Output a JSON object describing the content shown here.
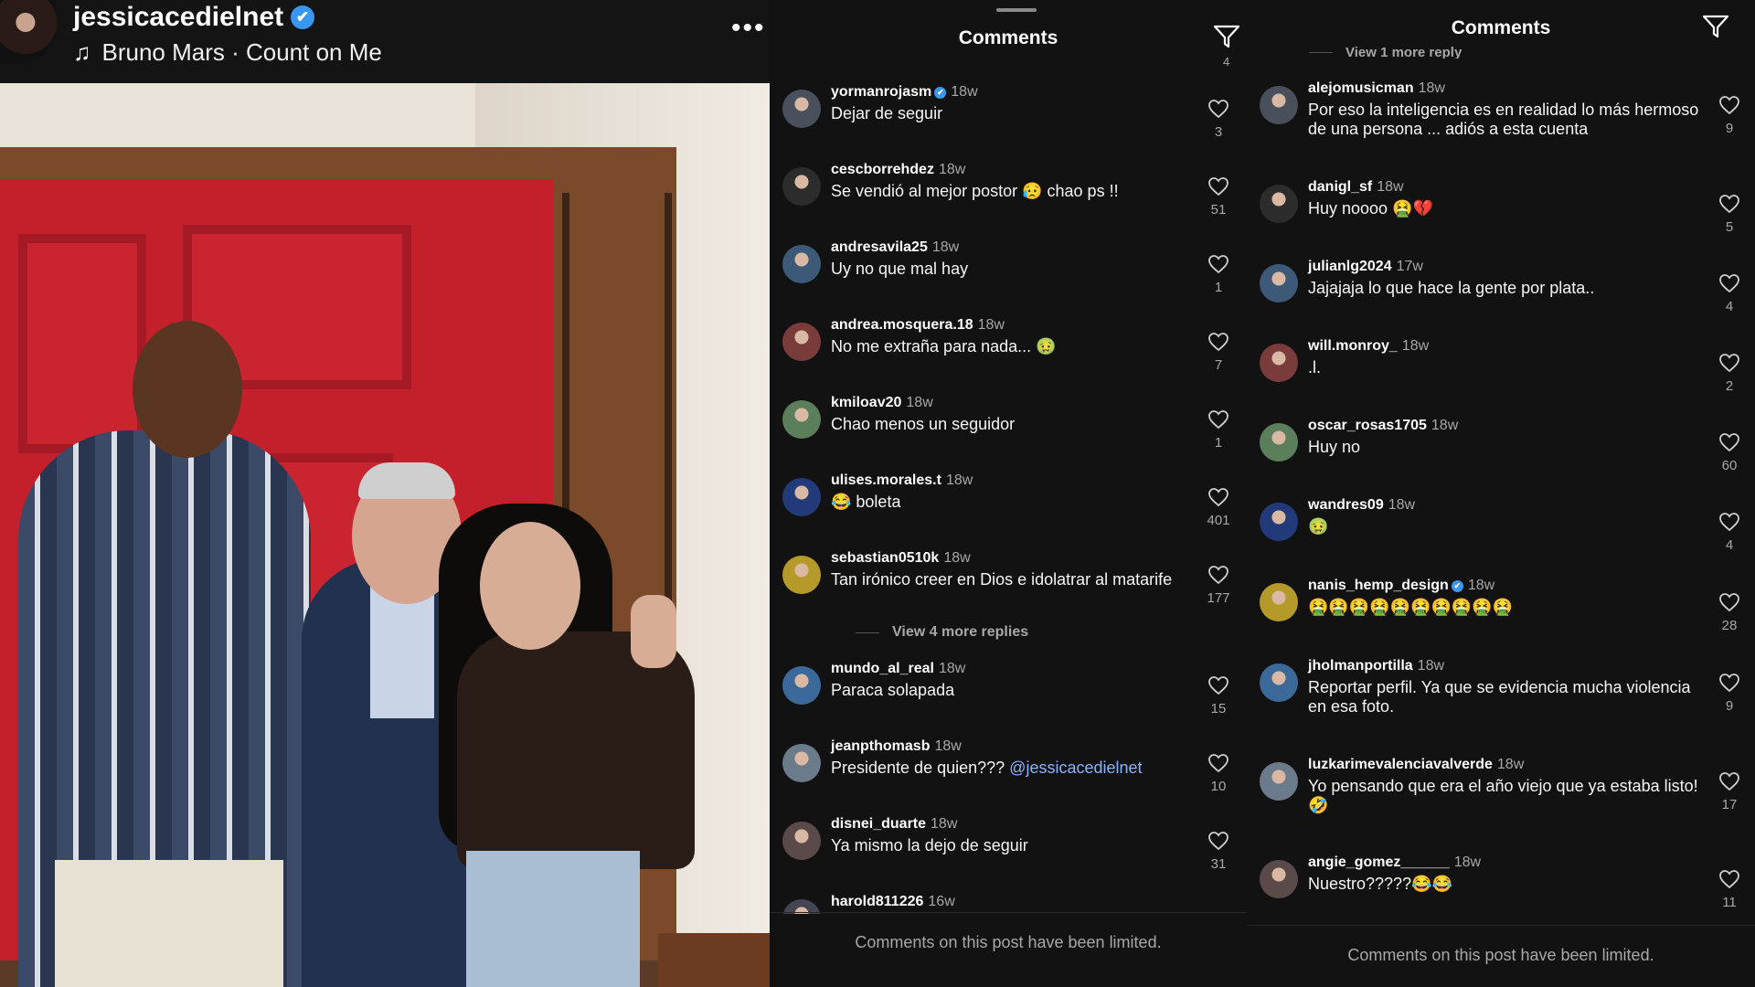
{
  "post": {
    "username": "jessicacedielnet",
    "music": "Bruno Mars · Count on Me",
    "more_label": "•••"
  },
  "panel_a": {
    "title": "Comments",
    "limited_notice": "Comments on this post have been limited.",
    "top_likes_partial": "4",
    "view_replies": "View 4 more replies",
    "comments": [
      {
        "user": "yormanrojasm",
        "verified": true,
        "time": "18w",
        "text": "Dejar de seguir",
        "likes": "3"
      },
      {
        "user": "cescborrehdez",
        "verified": false,
        "time": "18w",
        "text": "Se vendió al mejor postor 😥 chao ps !!",
        "likes": "51"
      },
      {
        "user": "andresavila25",
        "verified": false,
        "time": "18w",
        "text": "Uy no que mal hay",
        "likes": "1"
      },
      {
        "user": "andrea.mosquera.18",
        "verified": false,
        "time": "18w",
        "text": "No me extraña para nada... 🤢",
        "likes": "7"
      },
      {
        "user": "kmiloav20",
        "verified": false,
        "time": "18w",
        "text": "Chao menos un seguidor",
        "likes": "1"
      },
      {
        "user": "ulises.morales.t",
        "verified": false,
        "time": "18w",
        "text": "😂 boleta",
        "likes": "401"
      },
      {
        "user": "sebastian0510k",
        "verified": false,
        "time": "18w",
        "text": "Tan irónico creer en Dios e idolatrar al matarife",
        "likes": "177"
      },
      {
        "user": "mundo_al_real",
        "verified": false,
        "time": "18w",
        "text": "Paraca solapada",
        "likes": "15"
      },
      {
        "user": "jeanpthomasb",
        "verified": false,
        "time": "18w",
        "text": "Presidente de quien???",
        "mention": "@jessicacedielnet",
        "likes": "10"
      },
      {
        "user": "disnei_duarte",
        "verified": false,
        "time": "18w",
        "text": "Ya mismo la dejo de seguir",
        "likes": "31"
      },
      {
        "user": "harold811226",
        "verified": false,
        "time": "16w",
        "text": "",
        "likes": ""
      }
    ]
  },
  "panel_b": {
    "title": "Comments",
    "limited_notice": "Comments on this post have been limited.",
    "view_replies": "View 1 more reply",
    "comments": [
      {
        "user": "alejomusicman",
        "verified": false,
        "time": "18w",
        "text": "Por eso la inteligencia es en realidad lo más hermoso de una persona ... adiós a esta cuenta",
        "likes": "9"
      },
      {
        "user": "danigl_sf",
        "verified": false,
        "time": "18w",
        "text": "Huy noooo 🤮💔",
        "likes": "5"
      },
      {
        "user": "julianlg2024",
        "verified": false,
        "time": "17w",
        "text": "Jajajaja lo que hace la gente por plata..",
        "likes": "4"
      },
      {
        "user": "will.monroy_",
        "verified": false,
        "time": "18w",
        "text": ".l.",
        "likes": "2"
      },
      {
        "user": "oscar_rosas1705",
        "verified": false,
        "time": "18w",
        "text": "Huy no",
        "likes": "60"
      },
      {
        "user": "wandres09",
        "verified": false,
        "time": "18w",
        "text": "🤢",
        "likes": "4"
      },
      {
        "user": "nanis_hemp_design",
        "verified": true,
        "time": "18w",
        "text": "🤮🤮🤮🤮🤮🤮🤮🤮🤮🤮",
        "likes": "28"
      },
      {
        "user": "jholmanportilla",
        "verified": false,
        "time": "18w",
        "text": "Reportar perfil. Ya que se evidencia mucha violencia en esa foto.",
        "likes": "9"
      },
      {
        "user": "luzkarimevalenciavalverde",
        "verified": false,
        "time": "18w",
        "text": "Yo pensando que era el año viejo que ya estaba listo!🤣",
        "likes": "17"
      },
      {
        "user": "angie_gomez______",
        "verified": false,
        "time": "18w",
        "text": "Nuestro?????😂😂",
        "likes": "11"
      }
    ]
  },
  "icons": {
    "verified": "✔",
    "music": "♫",
    "heart": "heart-outline",
    "filter": "filter-funnel"
  },
  "colors": {
    "background": "#121212",
    "verified_blue": "#3897f0",
    "mention_blue": "#8ab4f8",
    "muted": "#a8a8a8"
  }
}
